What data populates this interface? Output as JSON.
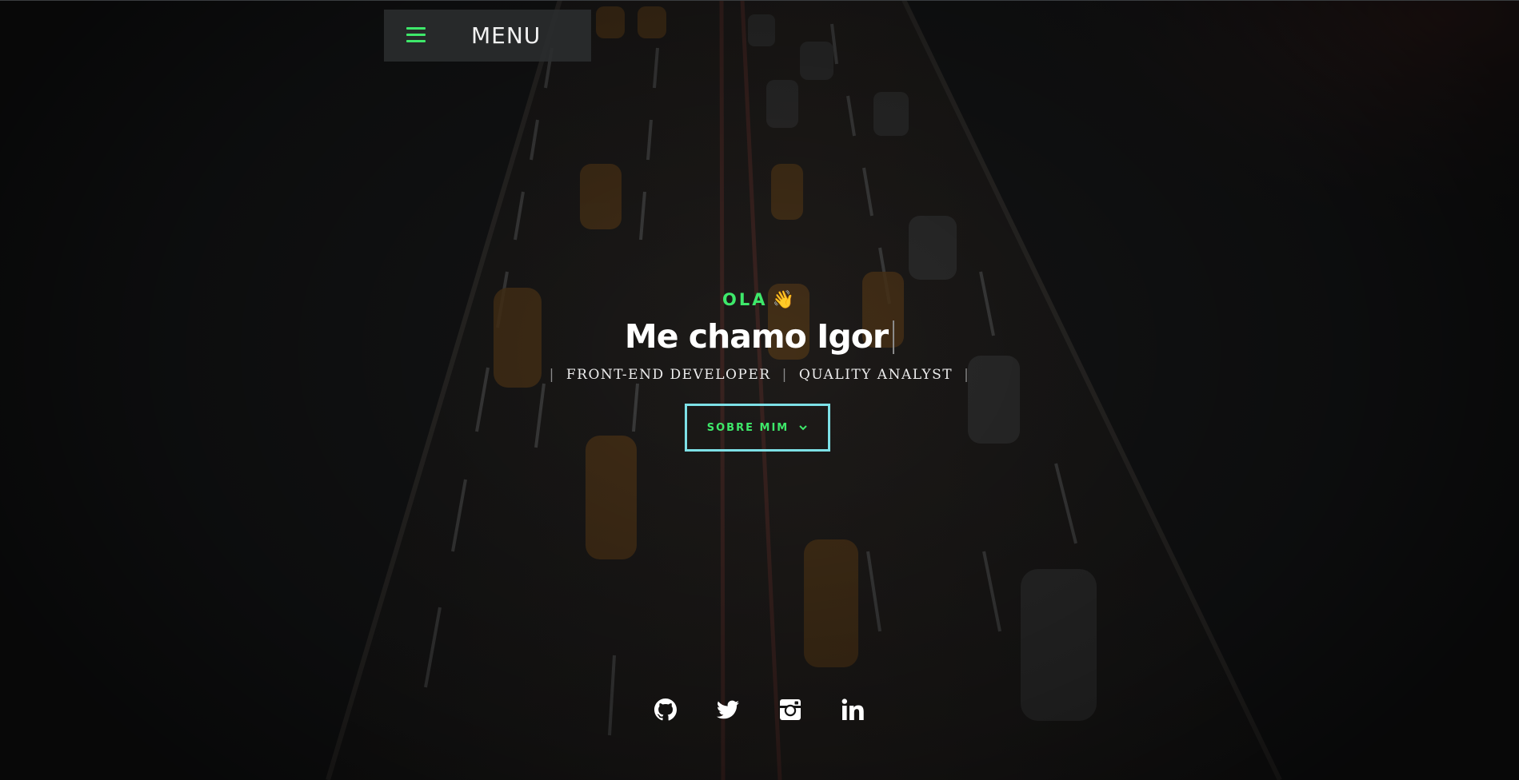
{
  "menu": {
    "label": "MENU",
    "icon": "hamburger-icon",
    "accent_color": "#3ee86a"
  },
  "hero": {
    "greeting": "OLA",
    "greeting_emoji": "👋",
    "name_heading": "Me chamo Igor",
    "roles": [
      "FRONT-END DEVELOPER",
      "QUALITY ANALYST"
    ],
    "cta_label": "SOBRE MIM",
    "cta_icon": "chevron-down-icon",
    "cta_border_color": "#7de0e6"
  },
  "social": [
    {
      "name": "github",
      "icon": "github-icon"
    },
    {
      "name": "twitter",
      "icon": "twitter-icon"
    },
    {
      "name": "instagram",
      "icon": "instagram-icon"
    },
    {
      "name": "linkedin",
      "icon": "linkedin-icon"
    }
  ],
  "colors": {
    "background": "#121314",
    "accent_green": "#3ee86a",
    "text": "#ffffff"
  }
}
